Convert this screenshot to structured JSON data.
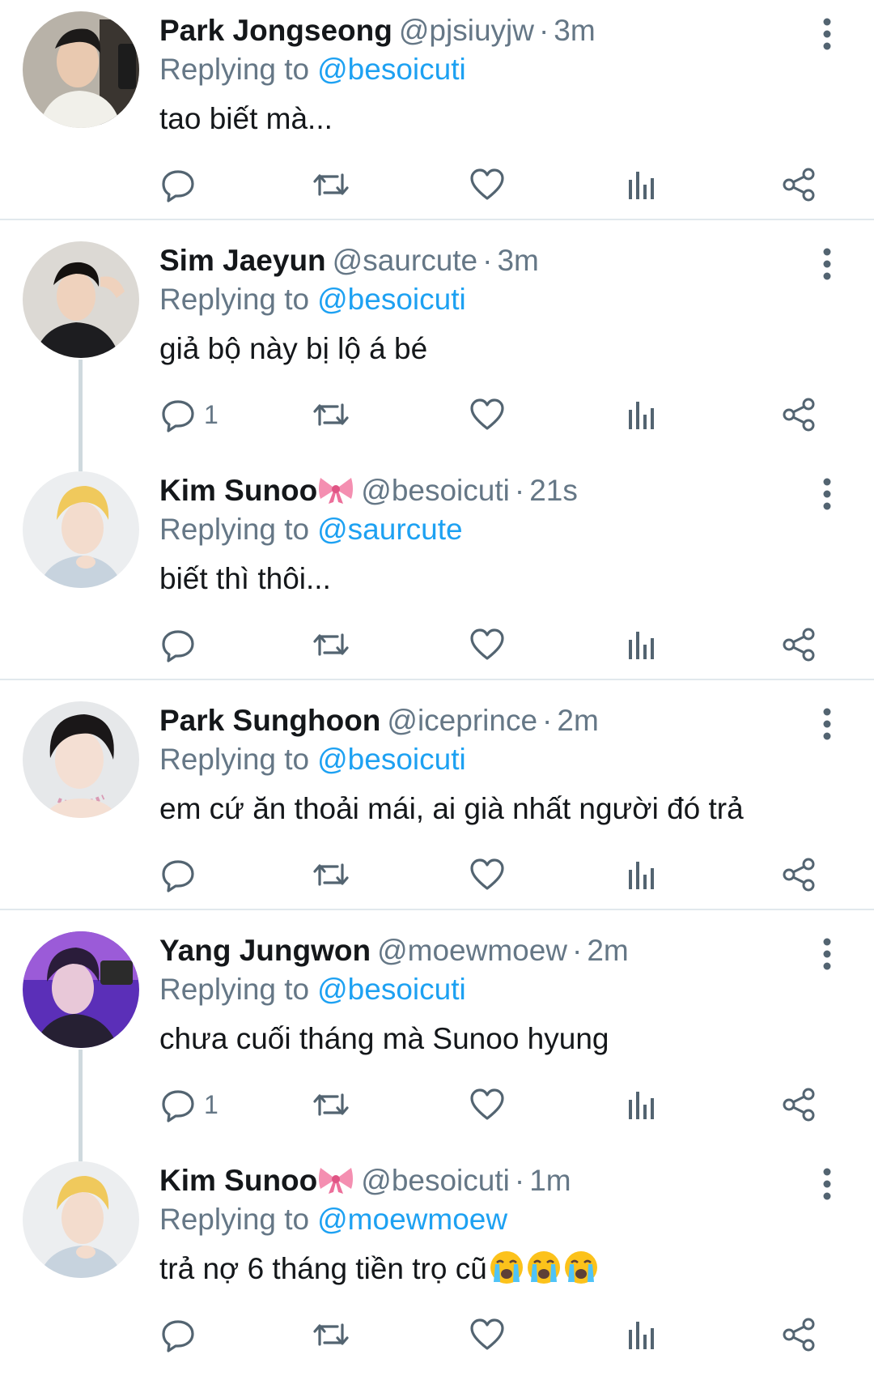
{
  "tweets": [
    {
      "display_name": "Park Jongseong",
      "has_bow_emoji": false,
      "handle": "@pjsiuyjw",
      "separator": "·",
      "time": "3m",
      "replying_prefix": "Replying to",
      "replying_handle": "@besoicuti",
      "text": "tao biết mà...",
      "reply_count": "",
      "avatar_icon": "avatar-photo"
    },
    {
      "display_name": "Sim Jaeyun",
      "has_bow_emoji": false,
      "handle": "@saurcute",
      "separator": "·",
      "time": "3m",
      "replying_prefix": "Replying to",
      "replying_handle": "@besoicuti",
      "text": "giả bộ này bị lộ á bé",
      "reply_count": "1",
      "avatar_icon": "avatar-photo"
    },
    {
      "display_name": "Kim Sunoo",
      "has_bow_emoji": true,
      "handle": "@besoicuti",
      "separator": "·",
      "time": "21s",
      "replying_prefix": "Replying to",
      "replying_handle": "@saurcute",
      "text": "biết thì thôi...",
      "reply_count": "",
      "avatar_icon": "avatar-photo"
    },
    {
      "display_name": "Park Sunghoon",
      "has_bow_emoji": false,
      "handle": "@iceprince",
      "separator": "·",
      "time": "2m",
      "replying_prefix": "Replying to",
      "replying_handle": "@besoicuti",
      "text": "em cứ ăn thoải mái, ai già nhất người đó trả",
      "reply_count": "",
      "avatar_icon": "avatar-photo"
    },
    {
      "display_name": "Yang Jungwon",
      "has_bow_emoji": false,
      "handle": "@moewmoew",
      "separator": "·",
      "time": "2m",
      "replying_prefix": "Replying to",
      "replying_handle": "@besoicuti",
      "text": "chưa cuối tháng mà Sunoo hyung",
      "reply_count": "1",
      "avatar_icon": "avatar-photo"
    },
    {
      "display_name": "Kim Sunoo",
      "has_bow_emoji": true,
      "handle": "@besoicuti",
      "separator": "·",
      "time": "1m",
      "replying_prefix": "Replying to",
      "replying_handle": "@moewmoew",
      "text": "trả nợ 6 tháng tiền trọ cũ",
      "trailing_emoji": "loudly-crying-face x3",
      "reply_count": "",
      "avatar_icon": "avatar-photo"
    }
  ],
  "icons": {
    "reply": "reply-bubble-icon",
    "retweet": "retweet-icon",
    "like": "heart-icon",
    "stats": "analytics-bars-icon",
    "share": "share-icon",
    "more": "vertical-ellipsis-icon"
  },
  "colors": {
    "text": "#14171a",
    "secondary": "#657786",
    "link": "#1da1f2",
    "divider": "#e1e8ed",
    "thread_line": "#cfd9de"
  }
}
